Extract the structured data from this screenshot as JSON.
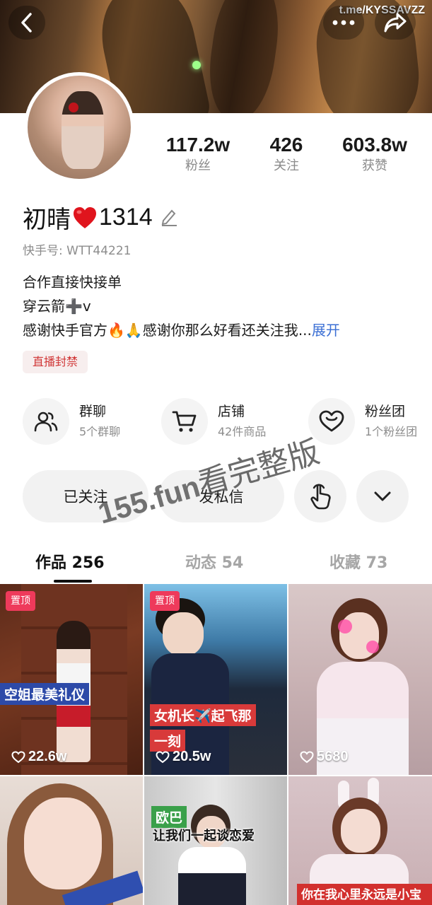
{
  "watermark_top": "t.me/KYSSAVZZ",
  "overlay_watermark": {
    "domain": "155.fun",
    "text": "看完整版"
  },
  "stats": [
    {
      "value": "117.2w",
      "label": "粉丝"
    },
    {
      "value": "426",
      "label": "关注"
    },
    {
      "value": "603.8w",
      "label": "获赞"
    }
  ],
  "profile": {
    "name_part1": "初晴",
    "name_part2": "1314",
    "kwai_id": "快手号: WTT44221",
    "bio_line1": "合作直接快接单",
    "bio_line2": "穿云箭➕v",
    "bio_line3": "感谢快手官方🔥🙏感谢你那么好看还关注我",
    "bio_ellipsis": "...",
    "bio_expand": "展开",
    "tag": "直播封禁"
  },
  "features": [
    {
      "title": "群聊",
      "sub": "5个群聊",
      "icon": "group-icon"
    },
    {
      "title": "店铺",
      "sub": "42件商品",
      "icon": "cart-icon"
    },
    {
      "title": "粉丝团",
      "sub": "1个粉丝团",
      "icon": "heart-outline-icon"
    }
  ],
  "actions": {
    "followed": "已关注",
    "message": "发私信"
  },
  "tabs": [
    {
      "label": "作品 256"
    },
    {
      "label": "动态 54"
    },
    {
      "label": "收藏 73"
    }
  ],
  "grid": [
    {
      "pinned": "置顶",
      "caption": "空姐最美礼仪",
      "likes": "22.6w"
    },
    {
      "pinned": "置顶",
      "caption1": "女机长✈️起飞那",
      "caption2": "一刻",
      "likes": "20.5w"
    },
    {
      "likes": "5680"
    },
    {},
    {
      "caption1": "欧巴",
      "caption2": "让我们一起谈恋爱"
    },
    {
      "caption": "你在我心里永远是小宝贝"
    }
  ],
  "colors": {
    "accent_red": "#ee3a5b",
    "link_blue": "#3b6fd4",
    "tag_red": "#d03535"
  }
}
